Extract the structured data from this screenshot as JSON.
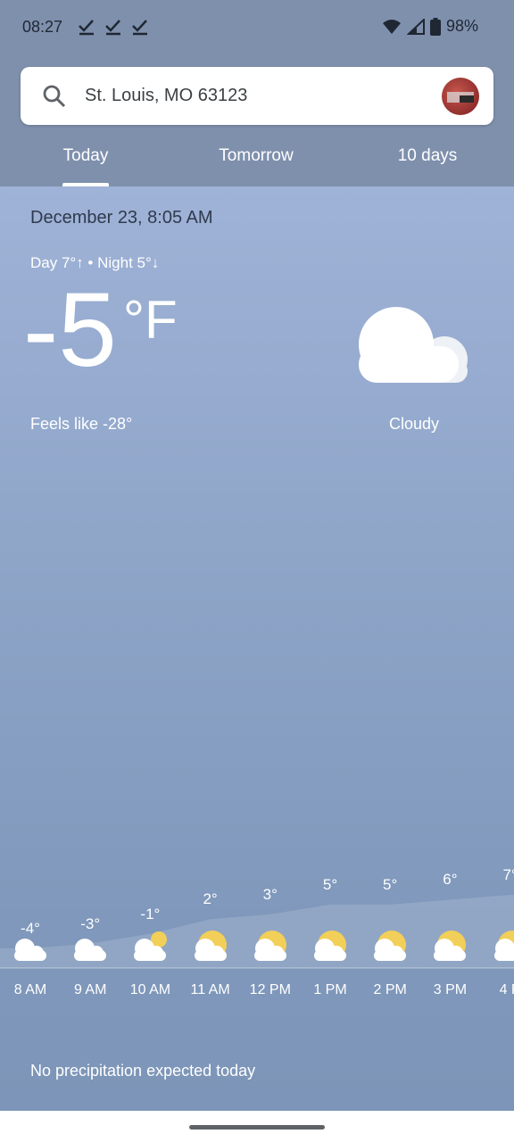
{
  "status": {
    "time": "08:27",
    "battery": "98%"
  },
  "search": {
    "location": "St. Louis, MO 63123"
  },
  "tabs": [
    "Today",
    "Tomorrow",
    "10 days"
  ],
  "current": {
    "date": "December 23, 8:05 AM",
    "day_night": "Day 7°↑ • Night 5°↓",
    "temp": "-5",
    "unit": "°F",
    "feels_like": "Feels like -28°",
    "condition": "Cloudy"
  },
  "hourly": [
    {
      "time": "8 AM",
      "temp": "-4°",
      "icon": "cloudy-icon"
    },
    {
      "time": "9 AM",
      "temp": "-3°",
      "icon": "cloudy-icon"
    },
    {
      "time": "10 AM",
      "temp": "-1°",
      "icon": "mostly-cloudy-icon"
    },
    {
      "time": "11 AM",
      "temp": "2°",
      "icon": "partly-cloudy-icon"
    },
    {
      "time": "12 PM",
      "temp": "3°",
      "icon": "partly-cloudy-icon"
    },
    {
      "time": "1 PM",
      "temp": "5°",
      "icon": "partly-cloudy-icon"
    },
    {
      "time": "2 PM",
      "temp": "5°",
      "icon": "partly-cloudy-icon"
    },
    {
      "time": "3 PM",
      "temp": "6°",
      "icon": "partly-cloudy-icon"
    },
    {
      "time": "4 P",
      "temp": "7°",
      "icon": "partly-cloudy-icon"
    }
  ],
  "precipitation": "No precipitation expected today"
}
